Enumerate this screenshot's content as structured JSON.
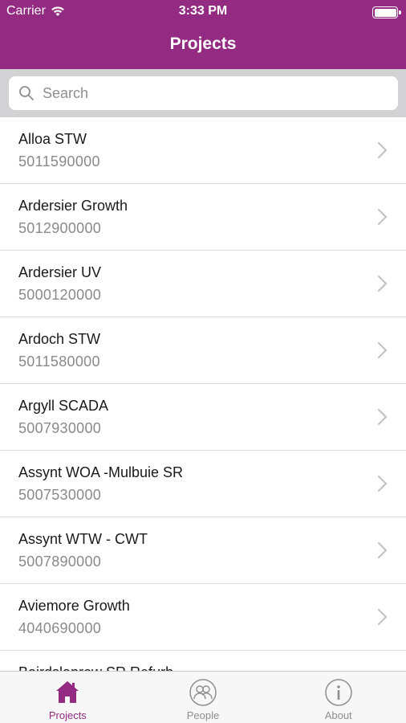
{
  "status_bar": {
    "carrier": "Carrier",
    "time": "3:33 PM",
    "battery_level": 1.0
  },
  "nav": {
    "title": "Projects"
  },
  "search": {
    "placeholder": "Search",
    "value": ""
  },
  "projects": [
    {
      "name": "Alloa STW",
      "code": "5011590000"
    },
    {
      "name": "Ardersier Growth",
      "code": "5012900000"
    },
    {
      "name": "Ardersier UV",
      "code": "5000120000"
    },
    {
      "name": "Ardoch STW",
      "code": "5011580000"
    },
    {
      "name": "Argyll SCADA",
      "code": "5007930000"
    },
    {
      "name": "Assynt WOA -Mulbuie SR",
      "code": "5007530000"
    },
    {
      "name": "Assynt WTW - CWT",
      "code": "5007890000"
    },
    {
      "name": "Aviemore Growth",
      "code": "4040690000"
    },
    {
      "name": "Bairdslanrow SR Refurb",
      "code": ""
    }
  ],
  "tabbar": {
    "tabs": [
      {
        "label": "Projects",
        "icon": "house-icon",
        "active": true
      },
      {
        "label": "People",
        "icon": "people-icon",
        "active": false
      },
      {
        "label": "About",
        "icon": "info-icon",
        "active": false
      }
    ]
  },
  "colors": {
    "brand": "#932b82",
    "search_bar_bg": "#d2d2d4",
    "secondary_text": "#8a8a8a",
    "tab_inactive": "#8e8e8e"
  }
}
